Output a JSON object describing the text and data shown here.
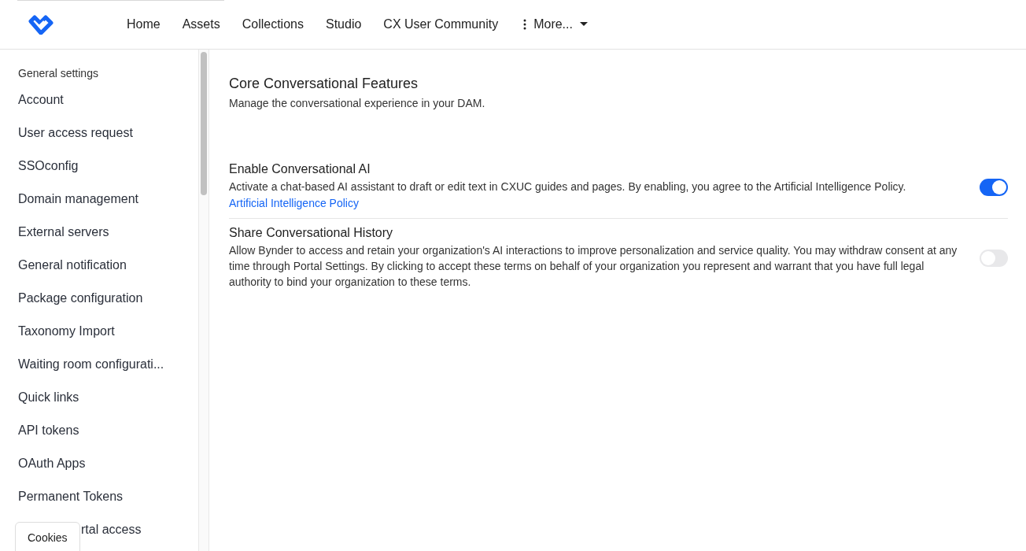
{
  "nav": {
    "items": [
      {
        "label": "Home"
      },
      {
        "label": "Assets"
      },
      {
        "label": "Collections"
      },
      {
        "label": "Studio"
      },
      {
        "label": "CX User Community"
      }
    ],
    "more": "More..."
  },
  "sidebar": {
    "heading": "General settings",
    "items": [
      {
        "label": "Account",
        "kind": "item"
      },
      {
        "label": "User access request",
        "kind": "item"
      },
      {
        "label": "SSOconfig",
        "kind": "item"
      },
      {
        "label": "Domain management",
        "kind": "item"
      },
      {
        "label": "External servers",
        "kind": "item"
      },
      {
        "label": "General notification",
        "kind": "item"
      },
      {
        "label": "Package configuration",
        "kind": "item"
      },
      {
        "label": "Taxonomy Import",
        "kind": "item"
      },
      {
        "label": "Waiting room configurati...",
        "kind": "item"
      },
      {
        "label": "Quick links",
        "kind": "item"
      },
      {
        "label": "API tokens",
        "kind": "item"
      },
      {
        "label": "OAuth Apps",
        "kind": "item"
      },
      {
        "label": "Permanent Tokens",
        "kind": "item"
      },
      {
        "label": "rtal access",
        "kind": "covered"
      }
    ]
  },
  "cookies_button": "Cookies",
  "section": {
    "title": "Core Conversational Features",
    "subtitle": "Manage the conversational experience in your DAM."
  },
  "settings": [
    {
      "title": "Enable Conversational AI",
      "description": "Activate a chat-based AI assistant to draft or edit text in CXUC guides and pages. By enabling, you agree to the Artificial Intelligence Policy.",
      "link": "Artificial Intelligence Policy",
      "on": true
    },
    {
      "title": "Share Conversational History",
      "description": "Allow Bynder to access and retain your organization's AI interactions to improve personalization and service quality. You may withdraw consent at any time through Portal Settings. By clicking to accept these terms on behalf of your organization you represent and warrant that you have full legal authority to bind your organization to these terms.",
      "on": false
    }
  ]
}
